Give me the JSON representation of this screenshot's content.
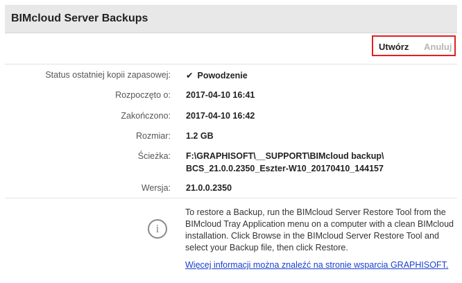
{
  "header": {
    "title": "BIMcloud Server Backups"
  },
  "actions": {
    "create_label": "Utwórz",
    "cancel_label": "Anuluj"
  },
  "details": {
    "status_label": "Status ostatniej kopii zapasowej:",
    "status_value": "Powodzenie",
    "started_label": "Rozpoczęto o:",
    "started_value": "2017-04-10 16:41",
    "finished_label": "Zakończono:",
    "finished_value": "2017-04-10 16:42",
    "size_label": "Rozmiar:",
    "size_value": "1.2 GB",
    "path_label": "Ścieżka:",
    "path_line1": "F:\\GRAPHISOFT\\__SUPPORT\\BIMcloud backup\\",
    "path_line2": "BCS_21.0.0.2350_Eszter-W10_20170410_144157",
    "version_label": "Wersja:",
    "version_value": "21.0.0.2350"
  },
  "info": {
    "text": "To restore a Backup, run the BIMcloud Server Restore Tool from the BIMcloud Tray Application menu on a computer with a clean BIMcloud installation. Click Browse in the BIMcloud Server Restore Tool and select your Backup file, then click Restore.",
    "link": "Więcej informacji można znaleźć na stronie wsparcia GRAPHISOFT."
  },
  "icons": {
    "status": "checkmark-icon",
    "info": "info-circle-icon"
  },
  "colors": {
    "highlight_border": "#e0201e",
    "link": "#1a3fcf",
    "header_bg": "#e8e8e8"
  }
}
